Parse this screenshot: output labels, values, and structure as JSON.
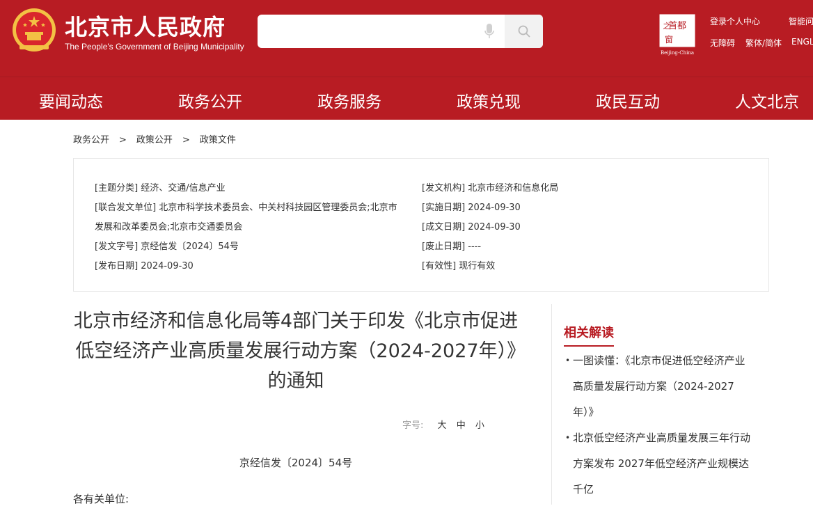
{
  "header": {
    "title": "北京市人民政府",
    "subtitle": "The People's Government of Beijing Municipality",
    "search": {
      "placeholder": ""
    },
    "capital_logo": {
      "top": "首都",
      "left": "之",
      "bottom": "窗",
      "caption": "Beijing-China"
    },
    "links": {
      "login": "登录",
      "personal_center": "个人中心",
      "assistant": "智能问",
      "accessibility": "无障碍",
      "traditional_simplified": "繁体/简体",
      "english": "ENGL"
    }
  },
  "nav": {
    "items": [
      "要闻动态",
      "政务公开",
      "政务服务",
      "政策兑现",
      "政民互动",
      "人文北京"
    ]
  },
  "breadcrumb": {
    "items": [
      "政务公开",
      "政策公开",
      "政策文件"
    ],
    "separator": ">"
  },
  "meta": {
    "left": {
      "topic": "[主题分类] 经济、交通/信息产业",
      "co_issuers_line1": "[联合发文单位] 北京市科学技术委员会、中关村科技园区管理委员会;北京市",
      "co_issuers_line2": "发展和改革委员会;北京市交通委员会",
      "doc_number": "[发文字号] 京经信发〔2024〕54号",
      "publish_date": "[发布日期] 2024-09-30"
    },
    "right": {
      "issuer": "[发文机构] 北京市经济和信息化局",
      "effective_date": "[实施日期] 2024-09-30",
      "written_date": "[成文日期] 2024-09-30",
      "repeal_date": "[废止日期] ----",
      "validity": "[有效性] 现行有效"
    }
  },
  "article": {
    "title": "北京市经济和信息化局等4部门关于印发《北京市促进低空经济产业高质量发展行动方案（2024-2027年）》的通知",
    "font_size_label": "字号:",
    "font_sizes": [
      "大",
      "中",
      "小"
    ],
    "doc_number": "京经信发〔2024〕54号",
    "salutation": "各有关单位:"
  },
  "related": {
    "title": "相关解读",
    "items": [
      {
        "lines": [
          "一图读懂：《北京市促进低空经济产业",
          "高质量发展行动方案（2024-2027",
          "年）》"
        ]
      },
      {
        "lines": [
          "北京低空经济产业高质量发展三年行动",
          "方案发布 2027年低空经济产业规模达",
          "千亿"
        ]
      }
    ]
  },
  "colors": {
    "brand_red": "#b81c23",
    "text": "#333333",
    "border": "#e6e6e6"
  }
}
